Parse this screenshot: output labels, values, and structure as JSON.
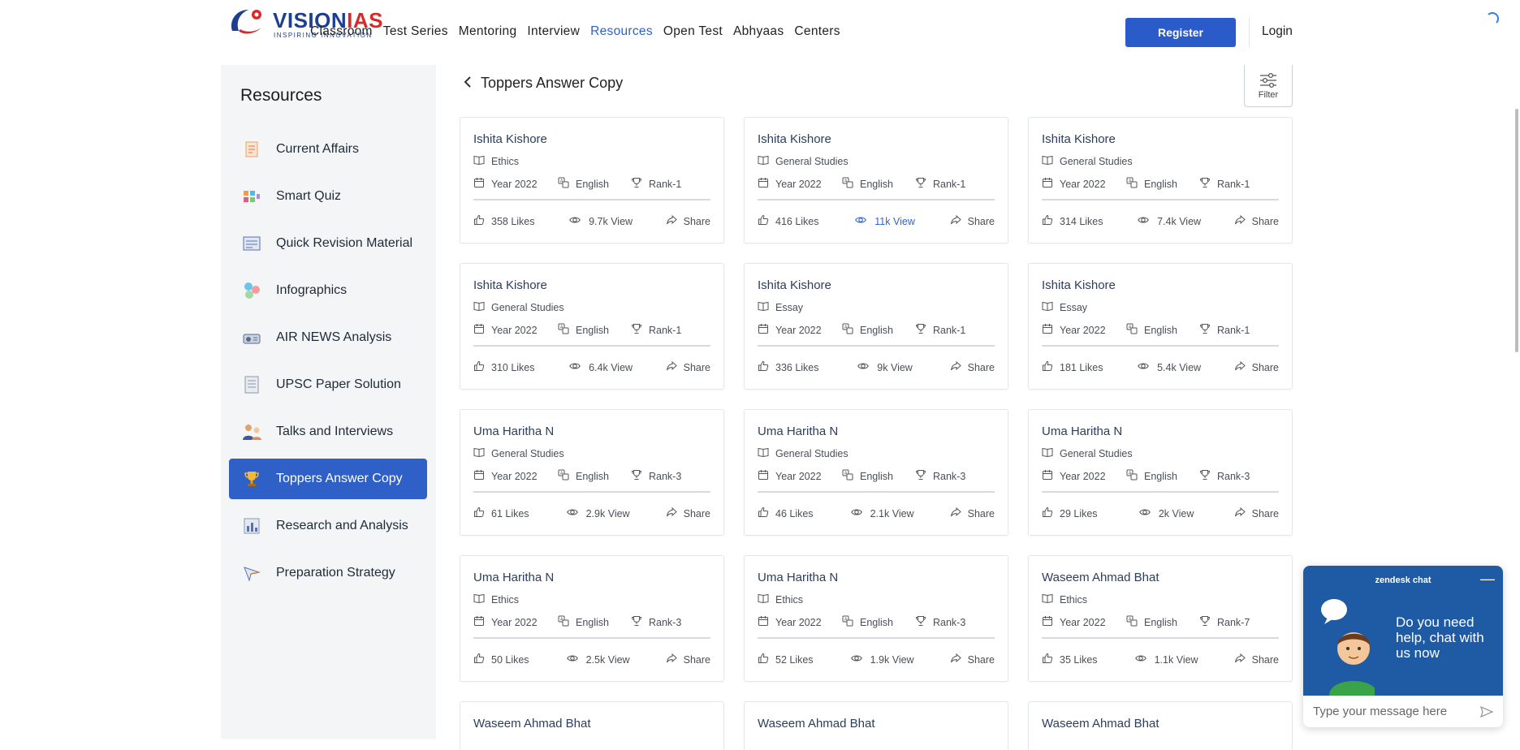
{
  "header": {
    "logo_brand_a": "VISION",
    "logo_brand_b": "IAS",
    "logo_tagline": "INSPIRING INNOVATION",
    "nav": [
      "Classroom",
      "Test Series",
      "Mentoring",
      "Interview",
      "Resources",
      "Open Test",
      "Abhyaas",
      "Centers"
    ],
    "nav_active": "Resources",
    "register_label": "Register",
    "login_label": "Login"
  },
  "sidebar": {
    "title": "Resources",
    "items": [
      {
        "label": "Current Affairs",
        "icon": "newspaper-icon"
      },
      {
        "label": "Smart Quiz",
        "icon": "quiz-icon"
      },
      {
        "label": "Quick Revision Material",
        "icon": "notes-icon"
      },
      {
        "label": "Infographics",
        "icon": "infographics-icon"
      },
      {
        "label": "AIR NEWS Analysis",
        "icon": "radio-icon"
      },
      {
        "label": "UPSC Paper Solution",
        "icon": "paper-icon"
      },
      {
        "label": "Talks and Interviews",
        "icon": "interview-icon"
      },
      {
        "label": "Toppers Answer Copy",
        "icon": "trophy-icon"
      },
      {
        "label": "Research and Analysis",
        "icon": "chart-icon"
      },
      {
        "label": "Preparation Strategy",
        "icon": "strategy-icon"
      }
    ],
    "active_index": 7
  },
  "main": {
    "back_title": "Toppers Answer Copy",
    "filter_label": "Filter",
    "cards": [
      {
        "name": "Ishita Kishore",
        "subject": "Ethics",
        "year": "Year 2022",
        "language": "English",
        "rank": "Rank-1",
        "likes": "358 Likes",
        "views": "9.7k View",
        "share": "Share",
        "views_highlight": false
      },
      {
        "name": "Ishita Kishore",
        "subject": "General Studies",
        "year": "Year 2022",
        "language": "English",
        "rank": "Rank-1",
        "likes": "416 Likes",
        "views": "11k View",
        "share": "Share",
        "views_highlight": true
      },
      {
        "name": "Ishita Kishore",
        "subject": "General Studies",
        "year": "Year 2022",
        "language": "English",
        "rank": "Rank-1",
        "likes": "314 Likes",
        "views": "7.4k View",
        "share": "Share",
        "views_highlight": false
      },
      {
        "name": "Ishita Kishore",
        "subject": "General Studies",
        "year": "Year 2022",
        "language": "English",
        "rank": "Rank-1",
        "likes": "310 Likes",
        "views": "6.4k View",
        "share": "Share",
        "views_highlight": false
      },
      {
        "name": "Ishita Kishore",
        "subject": "Essay",
        "year": "Year 2022",
        "language": "English",
        "rank": "Rank-1",
        "likes": "336 Likes",
        "views": "9k View",
        "share": "Share",
        "views_highlight": false
      },
      {
        "name": "Ishita Kishore",
        "subject": "Essay",
        "year": "Year 2022",
        "language": "English",
        "rank": "Rank-1",
        "likes": "181 Likes",
        "views": "5.4k View",
        "share": "Share",
        "views_highlight": false
      },
      {
        "name": "Uma Haritha N",
        "subject": "General Studies",
        "year": "Year 2022",
        "language": "English",
        "rank": "Rank-3",
        "likes": "61 Likes",
        "views": "2.9k View",
        "share": "Share",
        "views_highlight": false
      },
      {
        "name": "Uma Haritha N",
        "subject": "General Studies",
        "year": "Year 2022",
        "language": "English",
        "rank": "Rank-3",
        "likes": "46 Likes",
        "views": "2.1k View",
        "share": "Share",
        "views_highlight": false
      },
      {
        "name": "Uma Haritha N",
        "subject": "General Studies",
        "year": "Year 2022",
        "language": "English",
        "rank": "Rank-3",
        "likes": "29 Likes",
        "views": "2k View",
        "share": "Share",
        "views_highlight": false
      },
      {
        "name": "Uma Haritha N",
        "subject": "Ethics",
        "year": "Year 2022",
        "language": "English",
        "rank": "Rank-3",
        "likes": "50 Likes",
        "views": "2.5k View",
        "share": "Share",
        "views_highlight": false
      },
      {
        "name": "Uma Haritha N",
        "subject": "Ethics",
        "year": "Year 2022",
        "language": "English",
        "rank": "Rank-3",
        "likes": "52 Likes",
        "views": "1.9k View",
        "share": "Share",
        "views_highlight": false
      },
      {
        "name": "Waseem Ahmad Bhat",
        "subject": "Ethics",
        "year": "Year 2022",
        "language": "English",
        "rank": "Rank-7",
        "likes": "35 Likes",
        "views": "1.1k View",
        "share": "Share",
        "views_highlight": false
      }
    ],
    "partial_cards": [
      {
        "name": "Waseem Ahmad Bhat"
      },
      {
        "name": "Waseem Ahmad Bhat"
      },
      {
        "name": "Waseem Ahmad Bhat"
      }
    ]
  },
  "chat": {
    "brand": "zendesk chat",
    "message": "Do you need help, chat with us now",
    "input_placeholder": "Type your message here"
  },
  "colors": {
    "accent": "#2e60c8",
    "nav_active": "#2a63c4",
    "chat_bg": "#1f5ba4"
  }
}
